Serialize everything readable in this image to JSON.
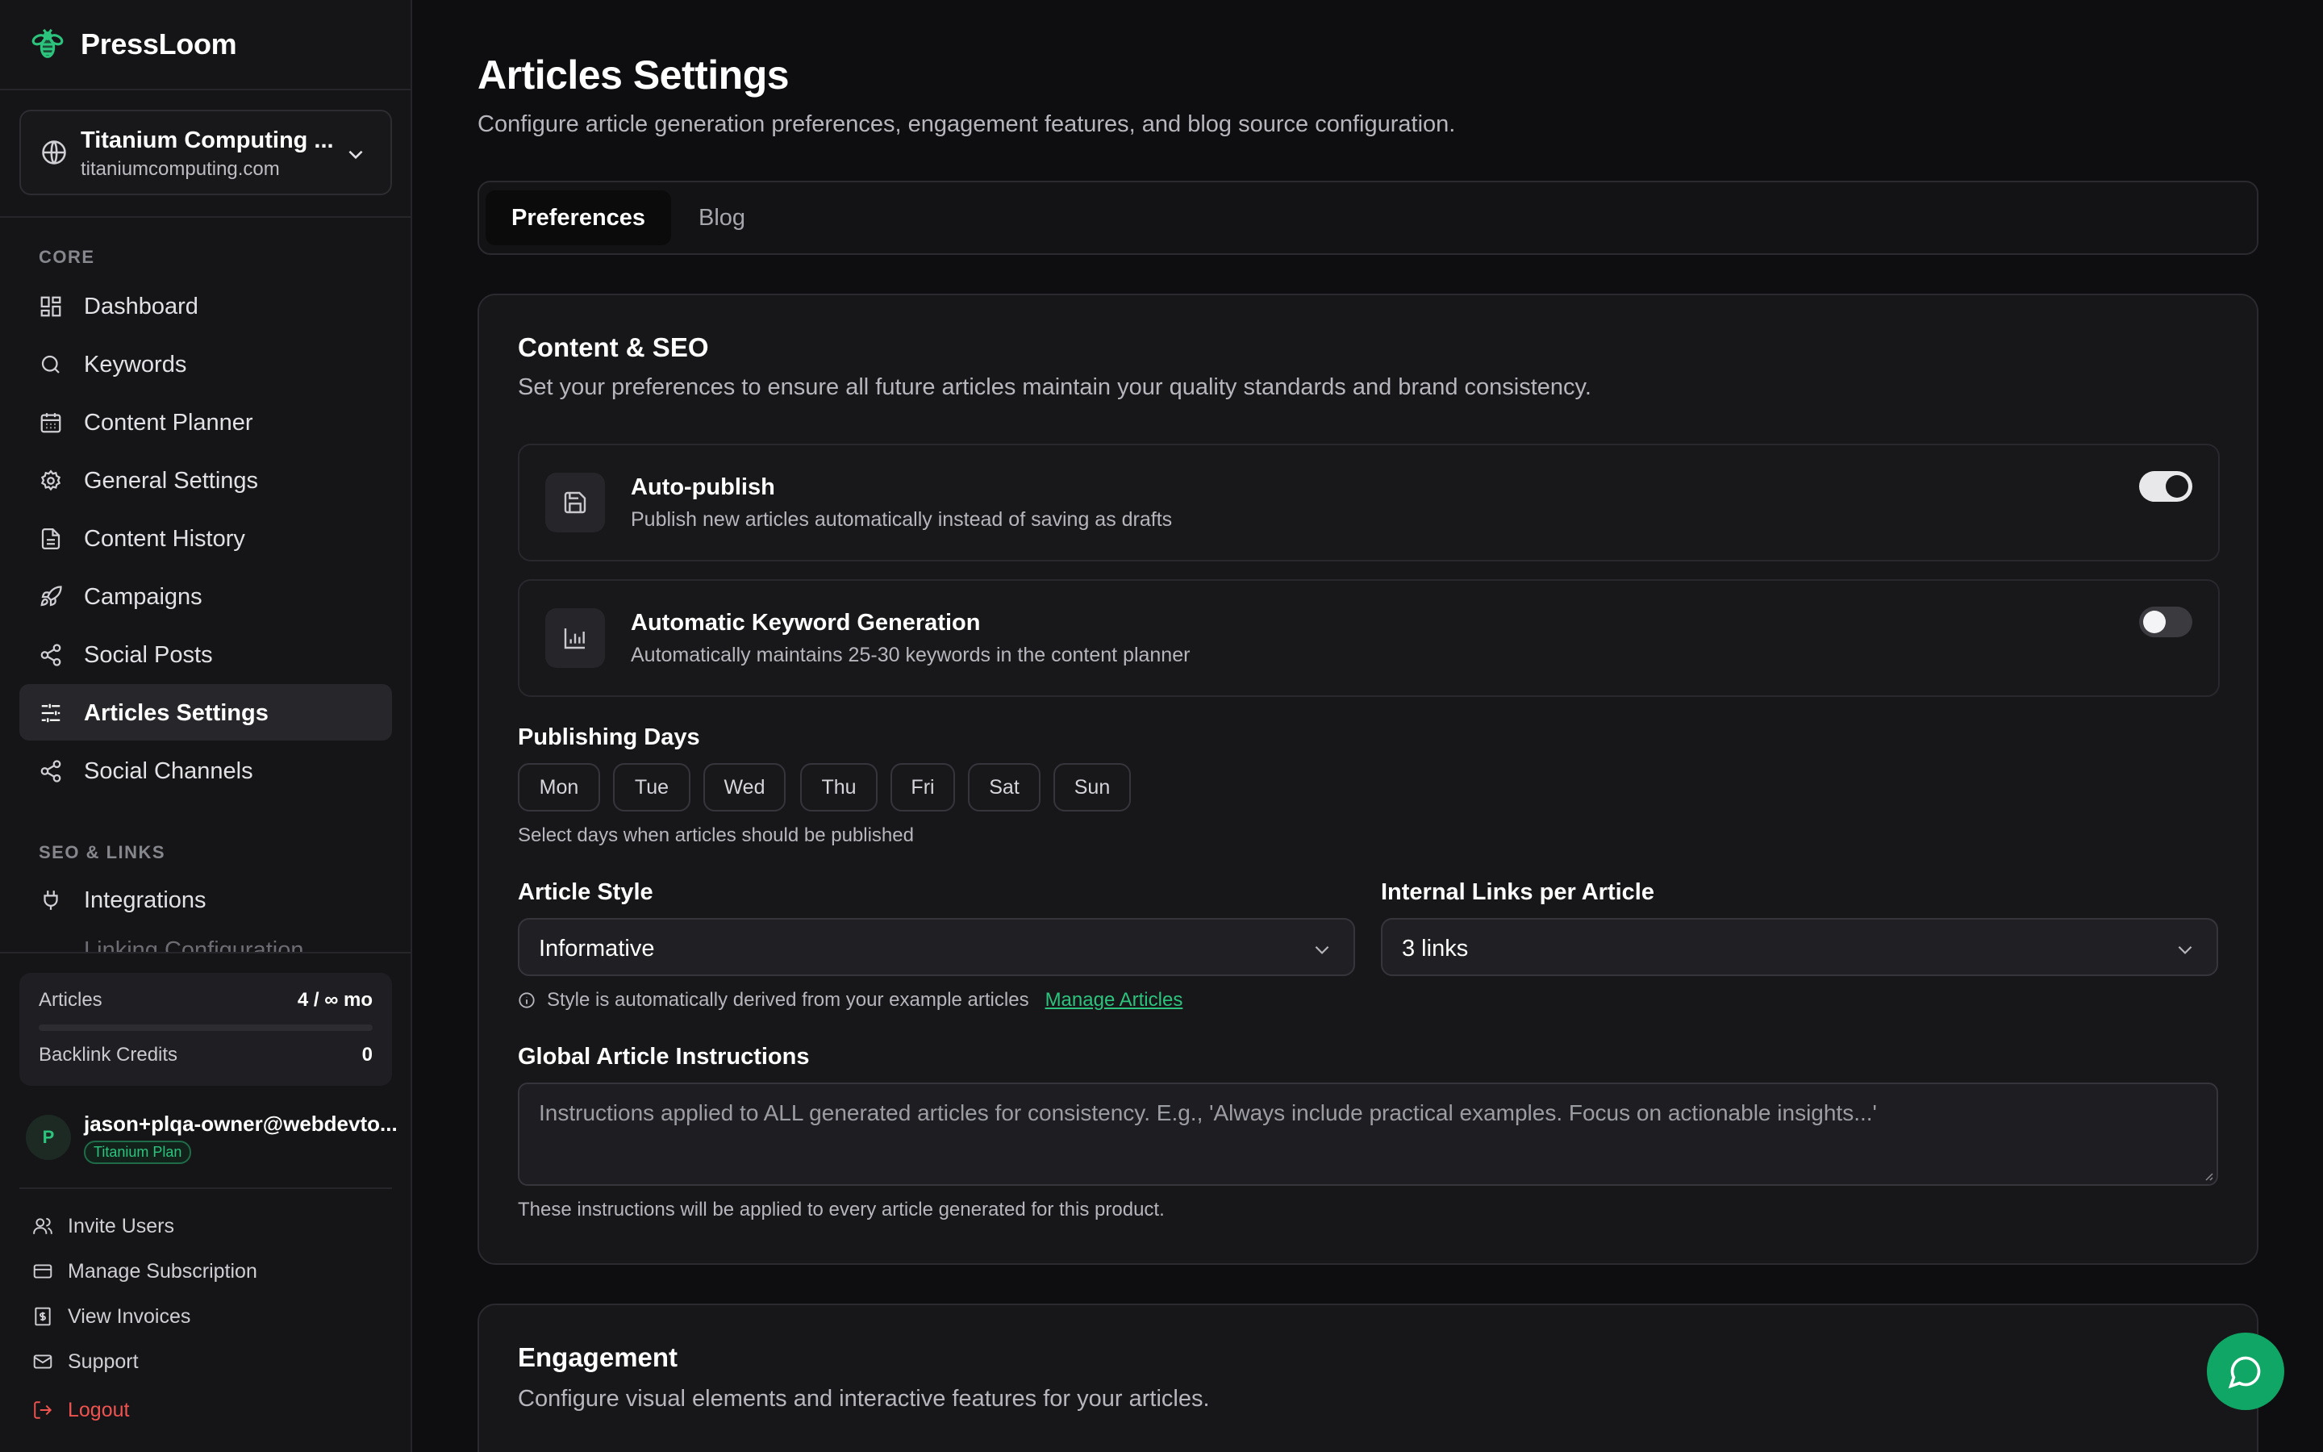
{
  "brand": {
    "name": "PressLoom"
  },
  "site": {
    "name": "Titanium Computing ...",
    "domain": "titaniumcomputing.com"
  },
  "sidebar": {
    "core_label": "CORE",
    "core_items": [
      {
        "label": "Dashboard",
        "icon": "dashboard-icon"
      },
      {
        "label": "Keywords",
        "icon": "search-icon"
      },
      {
        "label": "Content Planner",
        "icon": "calendar-icon"
      },
      {
        "label": "General Settings",
        "icon": "gear-icon"
      },
      {
        "label": "Content History",
        "icon": "document-icon"
      },
      {
        "label": "Campaigns",
        "icon": "rocket-icon"
      },
      {
        "label": "Social Posts",
        "icon": "share-icon"
      },
      {
        "label": "Articles Settings",
        "icon": "sliders-icon",
        "active": true
      },
      {
        "label": "Social Channels",
        "icon": "share-icon"
      }
    ],
    "seo_label": "SEO & LINKS",
    "seo_items": [
      {
        "label": "Integrations",
        "icon": "plug-icon"
      }
    ],
    "seo_faded_item": "Linking Configuration"
  },
  "usage": {
    "articles_label": "Articles",
    "articles_value": "4 / ∞ mo",
    "articles_fraction": 0,
    "backlink_label": "Backlink Credits",
    "backlink_value": "0"
  },
  "user": {
    "initial": "P",
    "email": "jason+plqa-owner@webdevto...",
    "plan": "Titanium Plan"
  },
  "footer": {
    "invite": "Invite Users",
    "subscription": "Manage Subscription",
    "invoices": "View Invoices",
    "support": "Support",
    "logout": "Logout"
  },
  "page": {
    "title": "Articles Settings",
    "subtitle": "Configure article generation preferences, engagement features, and blog source configuration."
  },
  "tabs": {
    "preferences": "Preferences",
    "blog": "Blog",
    "active": "Preferences"
  },
  "content_seo": {
    "title": "Content & SEO",
    "subtitle": "Set your preferences to ensure all future articles maintain your quality standards and brand consistency.",
    "auto_publish": {
      "title": "Auto-publish",
      "desc": "Publish new articles automatically instead of saving as drafts",
      "enabled": true
    },
    "auto_keywords": {
      "title": "Automatic Keyword Generation",
      "desc": "Automatically maintains 25-30 keywords in the content planner",
      "enabled": false
    },
    "publishing_days": {
      "label": "Publishing Days",
      "days": [
        "Mon",
        "Tue",
        "Wed",
        "Thu",
        "Fri",
        "Sat",
        "Sun"
      ],
      "help": "Select days when articles should be published"
    },
    "article_style": {
      "label": "Article Style",
      "value": "Informative"
    },
    "internal_links": {
      "label": "Internal Links per Article",
      "value": "3 links"
    },
    "style_note": "Style is automatically derived from your example articles",
    "manage_articles": "Manage Articles",
    "instructions": {
      "label": "Global Article Instructions",
      "placeholder": "Instructions applied to ALL generated articles for consistency. E.g., 'Always include practical examples. Focus on actionable insights...'",
      "help": "These instructions will be applied to every article generated for this product."
    }
  },
  "engagement": {
    "title": "Engagement",
    "subtitle": "Configure visual elements and interactive features for your articles."
  },
  "colors": {
    "accent": "#2cc37d",
    "fab": "#10a665",
    "logout": "#ef5350"
  }
}
